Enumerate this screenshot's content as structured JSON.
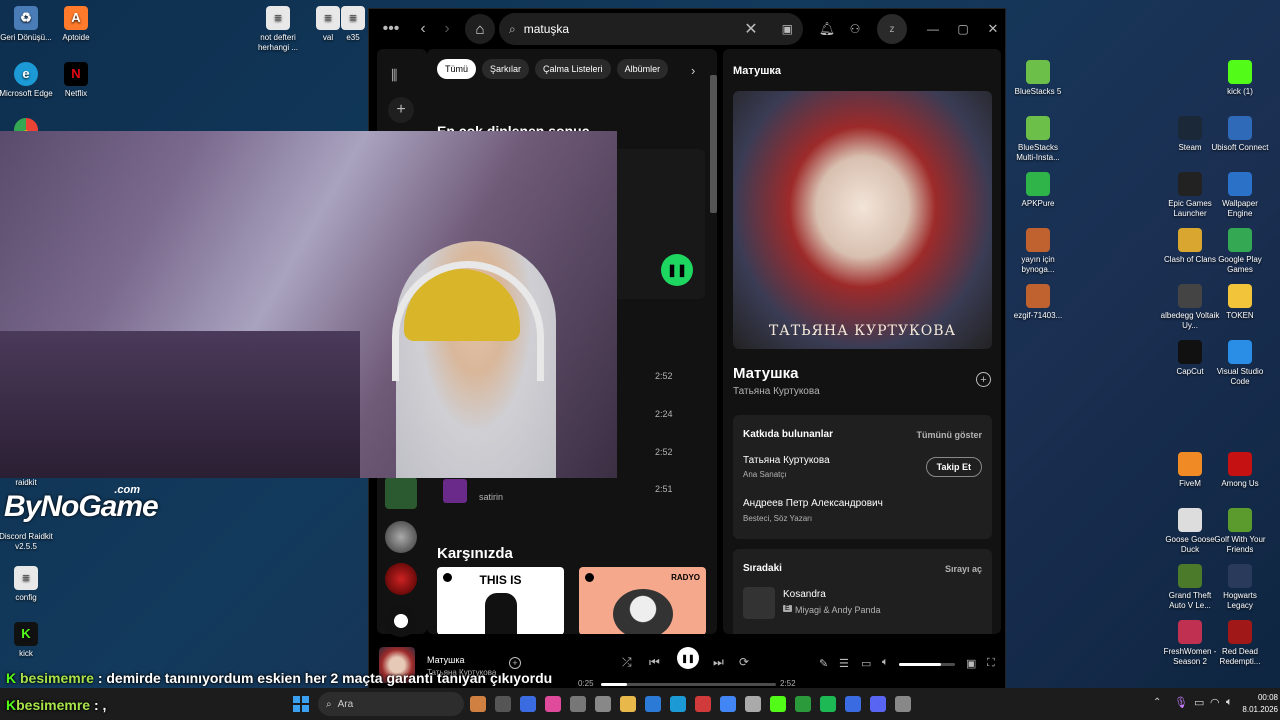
{
  "desktop": {
    "left_icons": [
      {
        "label": "Geri Dönüşü...",
        "color": "#4a7db8"
      },
      {
        "label": "Aptoide",
        "color": "#ff7a2a"
      },
      {
        "label": "not defteri herhangi ...",
        "color": "#e8e8e8"
      },
      {
        "label": "val",
        "color": "#e8e8e8"
      },
      {
        "label": "e35",
        "color": "#e8e8e8"
      },
      {
        "label": "Microsoft Edge",
        "color": "#1b9ad6"
      },
      {
        "label": "Netflix",
        "color": "#e50914"
      },
      {
        "label": "raidkit",
        "color": "#333"
      },
      {
        "label": "Discord Raidkit v2.5.5",
        "color": "#5865f2"
      },
      {
        "label": "config",
        "color": "#e8e8e8"
      },
      {
        "label": "kick",
        "color": "#53fc18"
      }
    ],
    "right_icons": [
      {
        "label": "BlueStacks 5",
        "color": "#6cc04a"
      },
      {
        "label": "BlueStacks Multi-Insta...",
        "color": "#6cc04a"
      },
      {
        "label": "APKPure",
        "color": "#2fb44a"
      },
      {
        "label": "yayın için bynoga...",
        "color": "#c0622f"
      },
      {
        "label": "ezgif-71403...",
        "color": "#c0622f"
      },
      {
        "label": "kick (1)",
        "color": "#53fc18"
      },
      {
        "label": "Steam",
        "color": "#1b2838"
      },
      {
        "label": "Ubisoft Connect",
        "color": "#2e6ab8"
      },
      {
        "label": "Epic Games Launcher",
        "color": "#222"
      },
      {
        "label": "Wallpaper Engine",
        "color": "#2b71c8"
      },
      {
        "label": "Clash of Clans",
        "color": "#d9a730"
      },
      {
        "label": "Google Play Games",
        "color": "#34a853"
      },
      {
        "label": "albedegg Voltaik Uy...",
        "color": "#444"
      },
      {
        "label": "TOKEN",
        "color": "#f2c43a"
      },
      {
        "label": "CapCut",
        "color": "#111"
      },
      {
        "label": "Visual Studio Code",
        "color": "#2a8ee6"
      },
      {
        "label": "FiveM",
        "color": "#f08a24"
      },
      {
        "label": "Among Us",
        "color": "#c51111"
      },
      {
        "label": "Goose Goose Duck",
        "color": "#ddd"
      },
      {
        "label": "Golf With Your Friends",
        "color": "#5b9b2e"
      },
      {
        "label": "Grand Theft Auto V Le...",
        "color": "#4a7a2a"
      },
      {
        "label": "Hogwarts Legacy",
        "color": "#2a3a5a"
      },
      {
        "label": "FreshWomen - Season 2",
        "color": "#c03050"
      },
      {
        "label": "Red Dead Redempti...",
        "color": "#a01818"
      }
    ],
    "logo_text": "ByNoGame",
    "logo_com": ".com"
  },
  "spotify": {
    "search_value": "matuşka",
    "chips": [
      "Tümü",
      "Şarkılar",
      "Çalma Listeleri",
      "Albümler"
    ],
    "top_result_title": "En çok dinlenen sonuç",
    "tracks": [
      {
        "duration": "2:52"
      },
      {
        "duration": "2:24"
      },
      {
        "duration": "2:52"
      },
      {
        "duration": "2:51",
        "artist": "satirin"
      }
    ],
    "featuring_title": "Karşınızda",
    "cards": [
      {
        "label": "THIS IS",
        "bg": "#ffffff",
        "fg": "#000"
      },
      {
        "label": "RADYO",
        "bg": "#f5a88c",
        "fg": "#000"
      }
    ],
    "now_playing_panel": {
      "header": "Матушка",
      "cover_caption": "ТАТЬЯНА КУРТУКОВА",
      "song_title": "Матушка",
      "song_artist": "Татьяна Куртукова",
      "credits_title": "Katkıda bulunanlar",
      "credits_show_all": "Tümünü göster",
      "credits": [
        {
          "name": "Татьяна Куртукова",
          "role": "Ana Sanatçı",
          "follow": "Takip Et"
        },
        {
          "name": "Андреев Петр Александрович",
          "role": "Besteci, Söz Yazarı"
        }
      ],
      "queue_title": "Sıradaki",
      "queue_open": "Sırayı aç",
      "queue_song": "Kosandra",
      "queue_artist": "Miyagi & Andy Panda",
      "explicit": "E"
    },
    "player": {
      "title": "Матушка",
      "artist": "Татьяна Куртукова",
      "elapsed": "0:25",
      "total": "2:52",
      "progress": 0.15,
      "volume": 0.75
    }
  },
  "chat": [
    {
      "user": "besimemre",
      "message": ": demirde tanınıyordum eskien her 2 maçta garanti tanıyan çıkıyordu"
    },
    {
      "user": "besimemre",
      "message": ": ,"
    }
  ],
  "taskbar": {
    "search_label": "Ara",
    "time": "00:08",
    "date": "8.01.2026"
  }
}
